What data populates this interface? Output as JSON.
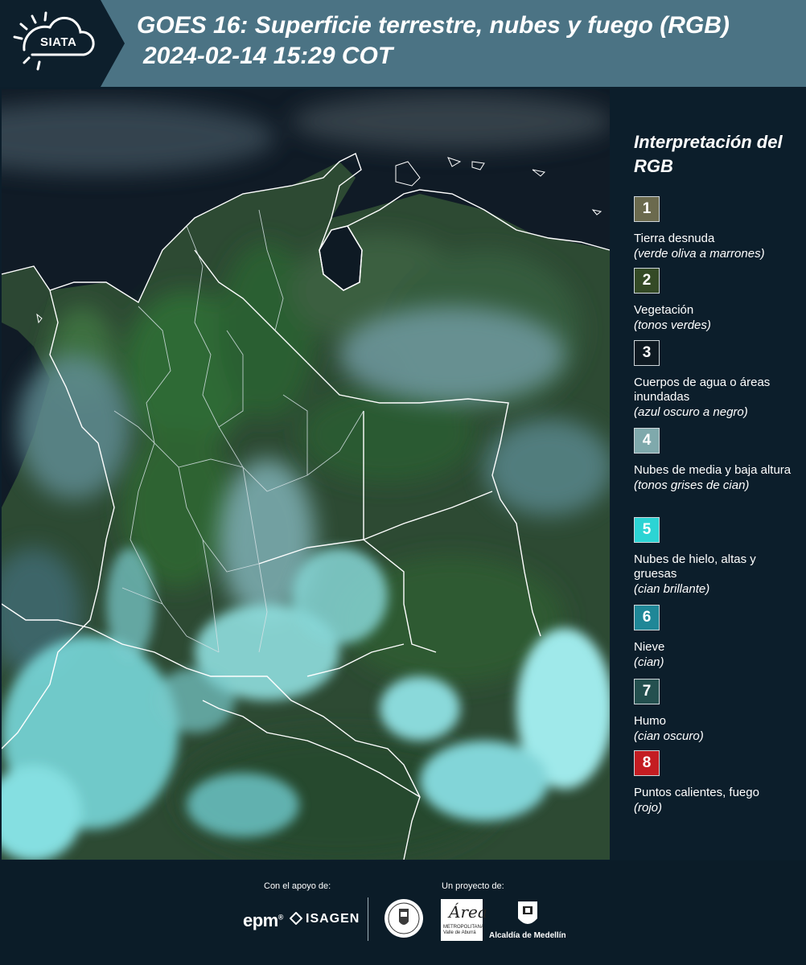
{
  "header": {
    "logo_text": "SIATA",
    "title": "GOES 16: Superficie terrestre, nubes y fuego (RGB)",
    "subtitle": "2024-02-14 15:29 COT"
  },
  "map": {
    "colors": {
      "ocean": "#0f1a24",
      "vegetation": "#2e5a31",
      "land_dark": "#243e2e",
      "cloud_low": "#8fb9bd",
      "cloud_ice": "#6fe3e6",
      "border": "#ffffff"
    }
  },
  "legend": {
    "title": "Interpretación del RGB",
    "items": [
      {
        "number": "1",
        "color": "#6b6a4e",
        "label": "Tierra desnuda",
        "desc": "(verde oliva a marrones)"
      },
      {
        "number": "2",
        "color": "#344a26",
        "label": "Vegetación",
        "desc": "(tonos verdes)"
      },
      {
        "number": "3",
        "color": "#0f1a22",
        "label": "Cuerpos de agua o áreas inundadas",
        "desc": "(azul oscuro a negro)"
      },
      {
        "number": "4",
        "color": "#7fa9ac",
        "label": "Nubes de media y baja altura",
        "desc": "(tonos grises de cian)"
      },
      {
        "number": "5",
        "color": "#2cd4d4",
        "label": "Nubes de hielo, altas y gruesas",
        "desc": "(cian brillante)"
      },
      {
        "number": "6",
        "color": "#1f8797",
        "label": "Nieve",
        "desc": "(cian)"
      },
      {
        "number": "7",
        "color": "#24504f",
        "label": "Humo",
        "desc": "(cian oscuro)"
      },
      {
        "number": "8",
        "color": "#c41d22",
        "label": "Puntos calientes, fuego",
        "desc": "(rojo)"
      }
    ]
  },
  "footer": {
    "support_caption": "Con el apoyo de:",
    "project_caption": "Un proyecto de:",
    "sponsors": [
      "epm",
      "ISAGEN"
    ],
    "partners": [
      "Área Metropolitana Valle de Aburrá",
      "Alcaldía de Medellín"
    ],
    "area_word": "Área",
    "area_caption": "METROPOLITANA Valle de Aburrá",
    "medellin_label": "Alcaldía de Medellín"
  }
}
